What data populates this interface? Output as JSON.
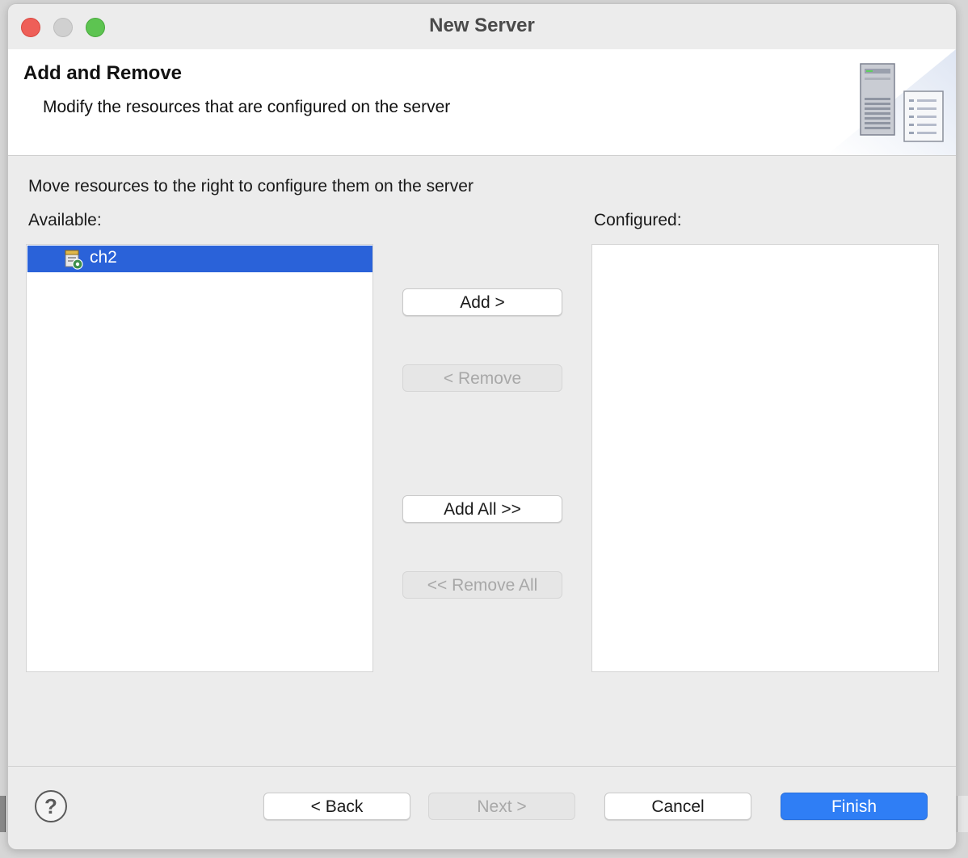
{
  "window": {
    "title": "New Server"
  },
  "header": {
    "title": "Add and Remove",
    "description": "Modify the resources that are configured on the server"
  },
  "instructions": "Move resources to the right to configure them on the server",
  "available": {
    "label": "Available:",
    "items": [
      {
        "label": "ch2",
        "selected": true,
        "icon": "project-icon"
      }
    ]
  },
  "configured": {
    "label": "Configured:",
    "items": []
  },
  "buttons": {
    "add": "Add >",
    "remove": "< Remove",
    "add_all": "Add All >>",
    "remove_all": "<< Remove All"
  },
  "footer": {
    "help": "?",
    "back": "< Back",
    "next": "Next >",
    "cancel": "Cancel",
    "finish": "Finish"
  },
  "colors": {
    "selection": "#2a62d9",
    "finish_button": "#2f7ef5",
    "close": "#ee5f58",
    "maximize": "#5dc451"
  }
}
